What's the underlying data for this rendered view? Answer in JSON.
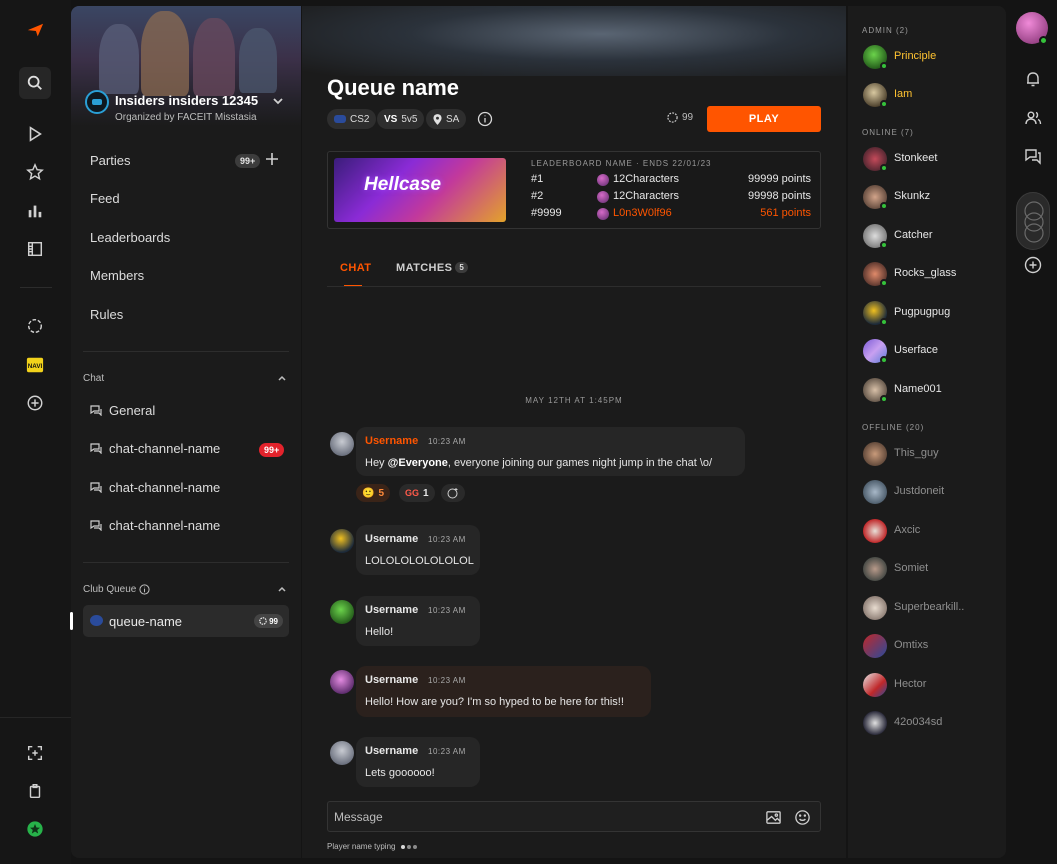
{
  "colors": {
    "accent": "#ff5500",
    "admin": "#ffc331",
    "online": "#35c23b",
    "badge_red": "#e3232c"
  },
  "rail": {
    "icons": [
      "faceit-logo-icon",
      "search-icon",
      "play-icon",
      "star-icon",
      "stats-icon",
      "film-icon",
      "circle-dots-icon",
      "navi-icon",
      "add-icon",
      "screenshot-icon",
      "clipboard-icon",
      "faceit-green-icon"
    ]
  },
  "club": {
    "name": "Insiders insiders 12345",
    "organizer": "Organized by FACEIT Misstasia",
    "nav": [
      {
        "label": "Parties",
        "badge": "99+"
      },
      {
        "label": "Feed"
      },
      {
        "label": "Leaderboards"
      },
      {
        "label": "Members"
      },
      {
        "label": "Rules"
      }
    ],
    "chat_section": "Chat",
    "channels": [
      {
        "label": "General"
      },
      {
        "label": "chat-channel-name",
        "badge": "99+"
      },
      {
        "label": "chat-channel-name"
      },
      {
        "label": "chat-channel-name"
      }
    ],
    "queue_section": "Club Queue",
    "queue_item": {
      "label": "queue-name",
      "count": "99"
    }
  },
  "queue": {
    "title": "Queue name",
    "game": "CS2",
    "mode_prefix": "VS",
    "mode": "5v5",
    "region": "SA",
    "count": "99",
    "play_label": "PLAY"
  },
  "leaderboard": {
    "banner_text": "Hellcase",
    "header": "LEADERBOARD NAME · ENDS 22/01/23",
    "rows": [
      {
        "rank": "#1",
        "name": "12Characters",
        "points": "99999 points",
        "self": false
      },
      {
        "rank": "#2",
        "name": "12Characters",
        "points": "99998 points",
        "self": false
      },
      {
        "rank": "#9999",
        "name": "L0n3W0lf96",
        "points": "561 points",
        "self": true
      }
    ]
  },
  "tabs": [
    {
      "label": "CHAT",
      "active": true
    },
    {
      "label": "MATCHES",
      "badge": "5",
      "active": false
    }
  ],
  "chat": {
    "date": "MAY 12TH AT 1:45PM",
    "messages": [
      {
        "user": "Username",
        "time": "10:23 AM",
        "pre": "Hey ",
        "mention": "@Everyone",
        "post": ", everyone joining our games night jump in the chat \\o/",
        "highlight": "mention"
      },
      {
        "user": "Username",
        "time": "10:23 AM",
        "text": "LOLOLOLOLOLOLOL"
      },
      {
        "user": "Username",
        "time": "10:23 AM",
        "text": "Hello!"
      },
      {
        "user": "Username",
        "time": "10:23 AM",
        "text": "Hello! How are you? I'm so hyped to be here for this!!",
        "highlight": "warm"
      },
      {
        "user": "Username",
        "time": "10:23 AM",
        "text": "Lets goooooo!"
      }
    ],
    "reactions": [
      {
        "emoji": "🙂",
        "count": "5"
      },
      {
        "emoji": "GG",
        "count": "1"
      }
    ],
    "composer_placeholder": "Message",
    "typing": "Player name typing"
  },
  "members": {
    "admin_head": "ADMIN (2)",
    "admins": [
      "Principle",
      "Iam"
    ],
    "online_head": "ONLINE (7)",
    "online": [
      "Stonkeet",
      "Skunkz",
      "Catcher",
      "Rocks_glass",
      "Pugpugpug",
      "Userface",
      "Name001"
    ],
    "offline_head": "OFFLINE (20)",
    "offline": [
      "This_guy",
      "Justdoneit",
      "Axcic",
      "Somiet",
      "Superbearkill..",
      "Omtixs",
      "Hector",
      "42o034sd"
    ]
  }
}
